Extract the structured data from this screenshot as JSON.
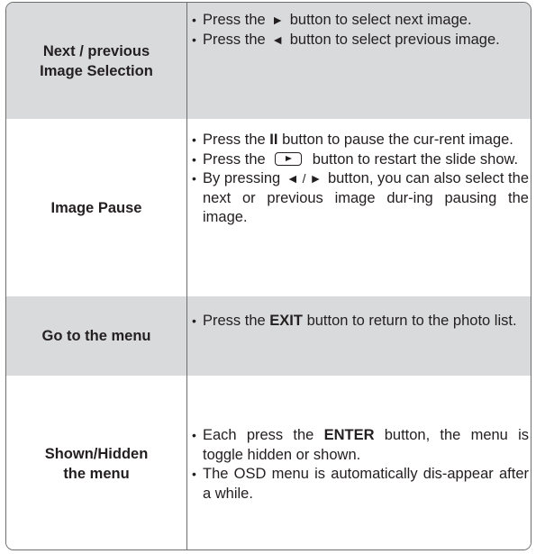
{
  "rows": [
    {
      "label": "Next / previous\nImage Selection",
      "bullets": [
        [
          "Press the",
          "►",
          "button to select next image."
        ],
        [
          "Press the",
          "◄",
          "button to select previous image."
        ]
      ]
    },
    {
      "label": "Image Pause",
      "bullets": [
        [
          "Press the",
          "II",
          "button to pause the cur-rent image."
        ],
        [
          "Press the",
          "",
          "button to restart the slide show."
        ],
        [
          "By pressing",
          "◄ / ►",
          "button, you can also select the next or previous image dur-ing pausing the image."
        ]
      ]
    },
    {
      "label": "Go to the menu",
      "bullets": [
        [
          "Press the",
          "EXIT",
          "button to return to the photo list."
        ]
      ]
    },
    {
      "label": "Shown/Hidden\nthe menu",
      "bullets": [
        [
          "Each press the",
          "ENTER",
          "button, the menu is toggle hidden or shown."
        ],
        [
          "The OSD menu is automatically dis-appear after a while.",
          "",
          ""
        ]
      ]
    }
  ],
  "icons": {
    "play_button": "play-button-icon",
    "bullet": "bullet-icon"
  },
  "colors": {
    "shaded_row": "#d9dadb",
    "border": "#6d6e70",
    "text": "#231f20"
  }
}
